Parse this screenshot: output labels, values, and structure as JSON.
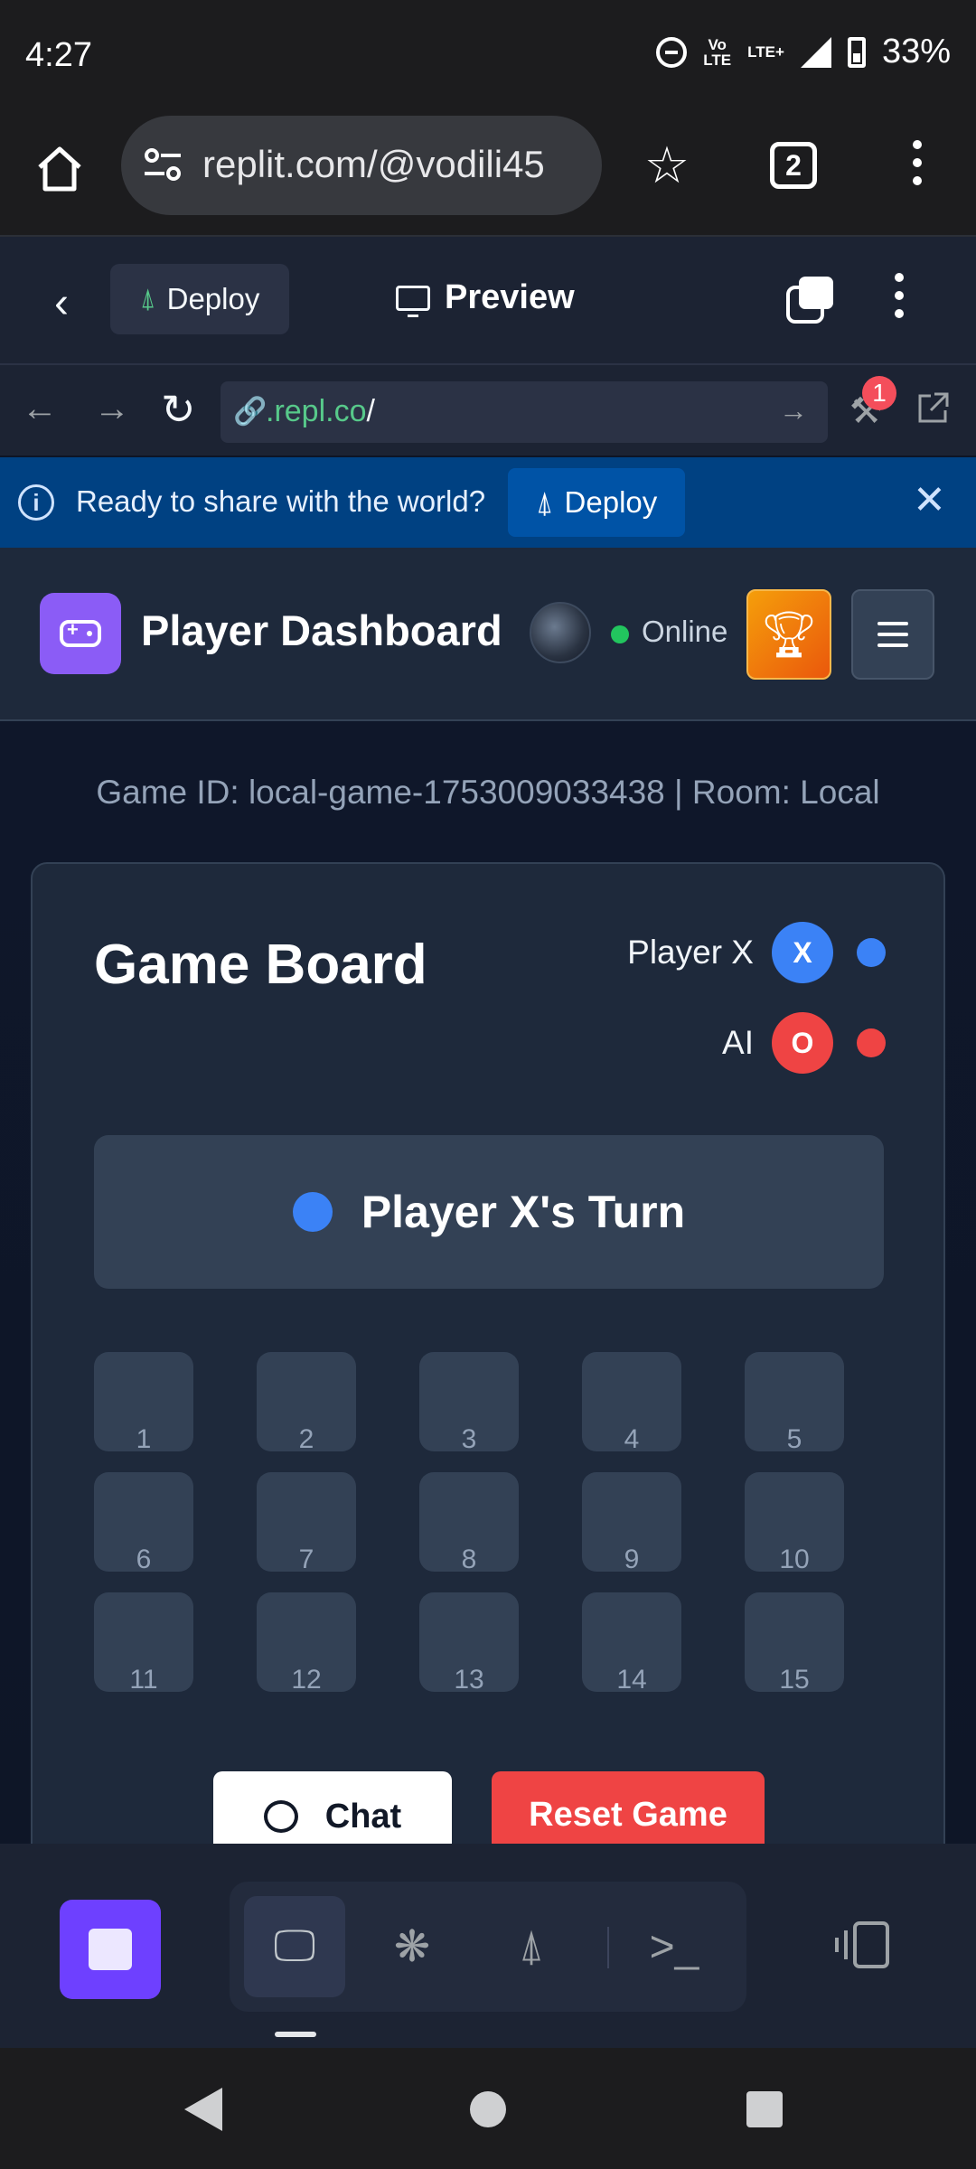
{
  "status": {
    "time": "4:27",
    "volte": "Vo LTE",
    "lte": "LTE+",
    "battery": "33%"
  },
  "browser": {
    "url": "replit.com/@vodili45",
    "tab_count": "2"
  },
  "replit": {
    "deploy_label": "Deploy",
    "preview_label": "Preview",
    "webview_url_host": ".repl.co",
    "webview_url_path": "/",
    "devtools_badge": "1"
  },
  "share_banner": {
    "text": "Ready to share with the world?",
    "deploy_label": "Deploy"
  },
  "app": {
    "title": "Player Dashboard",
    "status": "Online"
  },
  "game": {
    "id_line": "Game ID: local-game-1753009033438 | Room: Local",
    "board_title": "Game Board",
    "players": [
      {
        "name": "Player X",
        "symbol": "X",
        "color": "#3b82f6"
      },
      {
        "name": "AI",
        "symbol": "O",
        "color": "#ef4444"
      }
    ],
    "turn": "Player X's Turn",
    "cells": [
      "1",
      "2",
      "3",
      "4",
      "5",
      "6",
      "7",
      "8",
      "9",
      "10",
      "11",
      "12",
      "13",
      "14",
      "15"
    ],
    "chat_label": "Chat",
    "reset_label": "Reset Game"
  },
  "dock": {
    "items": [
      "monitor-icon",
      "extensions-icon",
      "deploy-icon",
      "shell-icon"
    ]
  },
  "colors": {
    "accent": "#8b5cf6",
    "replit_run": "#6e40ff",
    "banner": "#004182"
  }
}
